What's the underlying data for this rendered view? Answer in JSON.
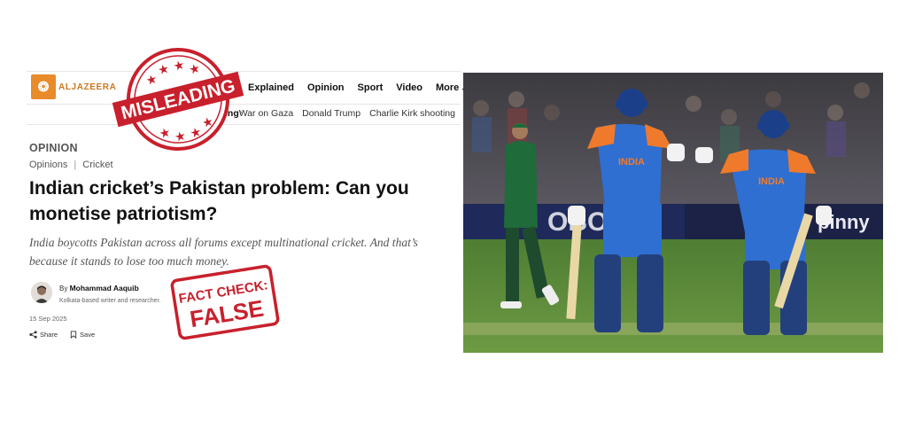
{
  "header": {
    "logo_text": "ALJAZEERA",
    "nav": [
      "Explained",
      "Opinion",
      "Sport",
      "Video",
      "More"
    ]
  },
  "trending": {
    "label_visible": "ing",
    "items": [
      "War on Gaza",
      "Donald Trump",
      "Charlie Kirk shooting"
    ]
  },
  "article": {
    "section": "OPINION",
    "breadcrumbs": [
      "Opinions",
      "Cricket"
    ],
    "headline": "Indian cricket’s Pakistan problem: Can you monetise patriotism?",
    "standfirst": "India boycotts Pakistan across all forums except multinational cricket. And that’s because it stands to lose too much money.",
    "byline_prefix": "By",
    "author": "Mohammad Aaquib",
    "author_bio": "Kolkata-based writer and researcher.",
    "date": "15 Sep 2025",
    "share_label": "Share",
    "save_label": "Save"
  },
  "stamps": {
    "misleading": "MISLEADING",
    "fact_check_line1": "FACT CHECK:",
    "fact_check_line2": "FALSE"
  },
  "photo": {
    "jersey_text": "INDIA",
    "ad_text_left": "OBO",
    "ad_text_right": "pinny"
  },
  "colors": {
    "brand_orange": "#e98b2a",
    "stamp_red": "#c8202c",
    "india_blue": "#2f6fd1",
    "india_orange": "#f07a2b",
    "pakistan_green": "#1f6b3a",
    "pitch_green": "#5f8f3a"
  }
}
